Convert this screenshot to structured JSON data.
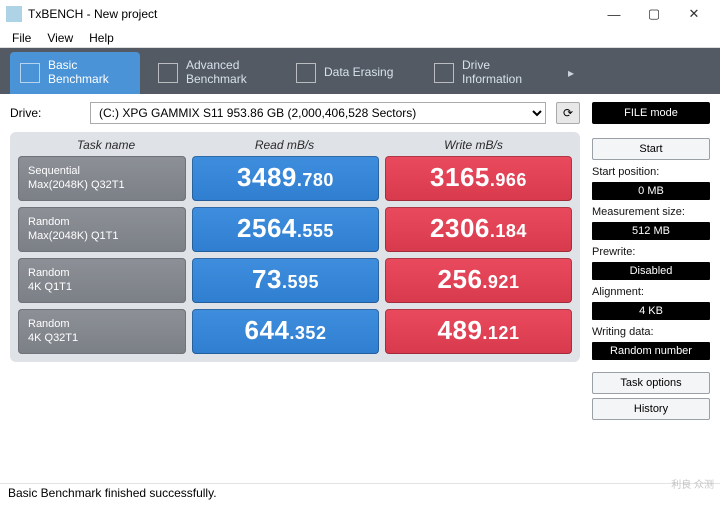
{
  "window": {
    "title": "TxBENCH - New project",
    "min": "—",
    "max": "▢",
    "close": "✕"
  },
  "menu": {
    "file": "File",
    "view": "View",
    "help": "Help"
  },
  "tabs": {
    "more": "▸",
    "items": [
      {
        "label": "Basic\nBenchmark",
        "active": true
      },
      {
        "label": "Advanced\nBenchmark",
        "active": false
      },
      {
        "label": "Data Erasing",
        "active": false
      },
      {
        "label": "Drive\nInformation",
        "active": false
      }
    ]
  },
  "drive": {
    "label": "Drive:",
    "selected": "(C:) XPG GAMMIX S11   953.86 GB  (2,000,406,528 Sectors)",
    "refresh_icon": "⟳"
  },
  "table": {
    "headers": {
      "task": "Task name",
      "read": "Read mB/s",
      "write": "Write mB/s"
    },
    "rows": [
      {
        "l1": "Sequential",
        "l2": "Max(2048K) Q32T1",
        "r_int": "3489",
        "r_dec": ".780",
        "w_int": "3165",
        "w_dec": ".966"
      },
      {
        "l1": "Random",
        "l2": "Max(2048K) Q1T1",
        "r_int": "2564",
        "r_dec": ".555",
        "w_int": "2306",
        "w_dec": ".184"
      },
      {
        "l1": "Random",
        "l2": "4K Q1T1",
        "r_int": "73",
        "r_dec": ".595",
        "w_int": "256",
        "w_dec": ".921"
      },
      {
        "l1": "Random",
        "l2": "4K Q32T1",
        "r_int": "644",
        "r_dec": ".352",
        "w_int": "489",
        "w_dec": ".121"
      }
    ]
  },
  "side": {
    "file_mode": "FILE mode",
    "start": "Start",
    "start_pos_label": "Start position:",
    "start_pos_val": "0 MB",
    "meas_label": "Measurement size:",
    "meas_val": "512 MB",
    "prewrite_label": "Prewrite:",
    "prewrite_val": "Disabled",
    "align_label": "Alignment:",
    "align_val": "4 KB",
    "wdata_label": "Writing data:",
    "wdata_val": "Random number",
    "task_opts": "Task options",
    "history": "History"
  },
  "status": "Basic Benchmark finished successfully.",
  "watermark": "利良 众测"
}
